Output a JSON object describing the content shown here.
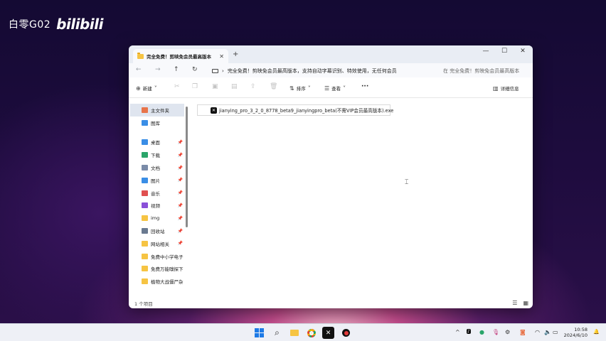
{
  "watermark": {
    "name": "白零G02",
    "logo": "bilibili"
  },
  "window": {
    "tab_title": "完全免费！剪映免会员最高版本",
    "tab_close": "✕",
    "new_tab": "+",
    "controls": {
      "minimize": "—",
      "maximize": "☐",
      "close": "✕"
    },
    "nav": {
      "back": "←",
      "forward": "→",
      "up": "↑",
      "refresh": "↻",
      "chevron": "›"
    },
    "address_path": "完全免费！剪映免会员最高版本，支持自动字幕识别、特效使用，无任何会员",
    "search_placeholder": "在 完全免费！剪映免会员最高版本",
    "toolbar": {
      "new_label": "新建",
      "sort_label": "排序",
      "view_label": "查看",
      "more_label": "···",
      "details_label": "详细信息"
    },
    "sidebar": {
      "top": [
        {
          "label": "主文件夹",
          "icon": "home-icon",
          "color": "#e8744a"
        },
        {
          "label": "图库",
          "icon": "gallery-icon",
          "color": "#3a8ee6"
        }
      ],
      "pinned": [
        {
          "label": "桌面",
          "icon": "desktop-icon",
          "color": "#3a8ee6",
          "pin": "📌"
        },
        {
          "label": "下载",
          "icon": "download-icon",
          "color": "#2aa56a",
          "pin": "📌"
        },
        {
          "label": "文档",
          "icon": "document-icon",
          "color": "#7a8ba8",
          "pin": "📌"
        },
        {
          "label": "图片",
          "icon": "pictures-icon",
          "color": "#3a8ee6",
          "pin": "📌"
        },
        {
          "label": "音乐",
          "icon": "music-icon",
          "color": "#e05050",
          "pin": "📌"
        },
        {
          "label": "视频",
          "icon": "video-icon",
          "color": "#8a50d8",
          "pin": "📌"
        },
        {
          "label": "img",
          "icon": "folder-icon",
          "color": "#f6c443",
          "pin": "📌"
        },
        {
          "label": "回收站",
          "icon": "recycle-bin-icon",
          "color": "#6a7a90",
          "pin": "📌"
        },
        {
          "label": "网站相关",
          "icon": "folder-icon",
          "color": "#f6c443",
          "pin": "📌"
        },
        {
          "label": "免费中小学电子",
          "icon": "folder-icon",
          "color": "#f6c443",
          "pin": ""
        },
        {
          "label": "免费万能嗅探下",
          "icon": "folder-icon",
          "color": "#f6c443",
          "pin": ""
        },
        {
          "label": "植物大战僵尸杂",
          "icon": "folder-icon",
          "color": "#f6c443",
          "pin": ""
        }
      ]
    },
    "files": [
      {
        "name": "jianying_pro_3_2_0_8778_beta9_jianyingpro_beta(不需VIP会员最高版本).exe",
        "icon": "capcut-app-icon"
      }
    ],
    "status": "1 个项目"
  },
  "taskbar": {
    "time": "10:58",
    "date": "2024/6/10",
    "tray_chevron": "^"
  }
}
